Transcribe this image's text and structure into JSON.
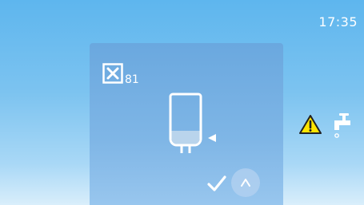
{
  "status_bar": {
    "time": "17:35"
  },
  "dialog": {
    "error_icon": "cross-box-icon",
    "error_code": "81",
    "illustration": "bag-icon",
    "pointer": "pointer-left-icon",
    "confirm_icon": "checkmark-icon",
    "up_icon": "chevron-up-icon"
  },
  "alerts": {
    "warning_icon": "warning-icon",
    "tap_icon": "water-tap-icon"
  },
  "colors": {
    "background_top": "#5eb6ee",
    "background_bottom": "#d9eefb",
    "card": "#7fb6e6",
    "warning_yellow": "#ffe500",
    "icon_white": "#ffffff"
  }
}
